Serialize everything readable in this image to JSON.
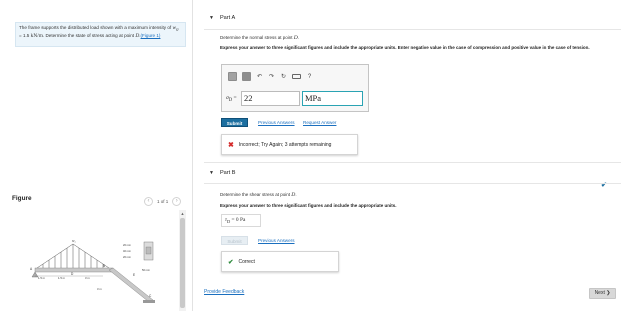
{
  "problem": {
    "text_before": "The frame supports the distributed load shown with a maximum intensity of ",
    "w0": "w",
    "w0_sub": "0",
    "equals": " = 1.5 ",
    "unit": "kN/m",
    "text_after": ". Determine the state of stress acting at point ",
    "point": "D",
    "period": ". ",
    "figure_link": "(Figure 1)"
  },
  "figure": {
    "label": "Figure",
    "prev_icon": "‹",
    "next_icon": "›",
    "count": "1 of 1",
    "scroll_up_icon": "▲",
    "drawing_labels": {
      "load": "w₀",
      "a": "A",
      "b": "B",
      "c": "C",
      "d": "D",
      "e": "E",
      "dim_top": "20 mm",
      "dim_mid": "40 mm",
      "dim_bot": "20 mm",
      "dim_width": "50 mm",
      "span_1": "1.5 m",
      "span_2": "1.5 m",
      "span_3": "3 m",
      "height": "3 m"
    }
  },
  "part_a": {
    "caret": "▼",
    "title": "Part A",
    "prompt": "Determine the normal stress at point ",
    "point": "D",
    "prompt_end": ".",
    "instructions": "Express your answer to three significant figures and include the appropriate units. Enter negative value in the case of compression and positive value in the case of tension.",
    "toolbar": {
      "undo_icon": "↶",
      "redo_icon": "↷",
      "reset_icon": "↻",
      "help_icon": "?"
    },
    "answer_symbol": "σ",
    "answer_sub": "D",
    "answer_eq": " =",
    "answer_value": "22",
    "answer_unit": "MPa",
    "submit_label": "Submit",
    "previous_answers": "Previous Answers",
    "request_answer": "Request Answer",
    "feedback_icon": "✖",
    "feedback_text": "Incorrect; Try Again; 3 attempts remaining"
  },
  "part_b": {
    "caret": "▼",
    "title": "Part B",
    "complete_icon": "✔",
    "prompt": "Determine the shear stress at point ",
    "point": "D",
    "prompt_end": ".",
    "instructions": "Express your answer to three significant figures and include the appropriate units.",
    "answer_symbol": "τ",
    "answer_sub": "D",
    "answer_rest": " = 0 Pa",
    "submit_label": "Submit",
    "previous_answers": "Previous Answers",
    "feedback_icon": "✔",
    "feedback_text": "Correct"
  },
  "footer": {
    "provide_feedback": "Provide Feedback",
    "next_label": "Next ❯"
  }
}
